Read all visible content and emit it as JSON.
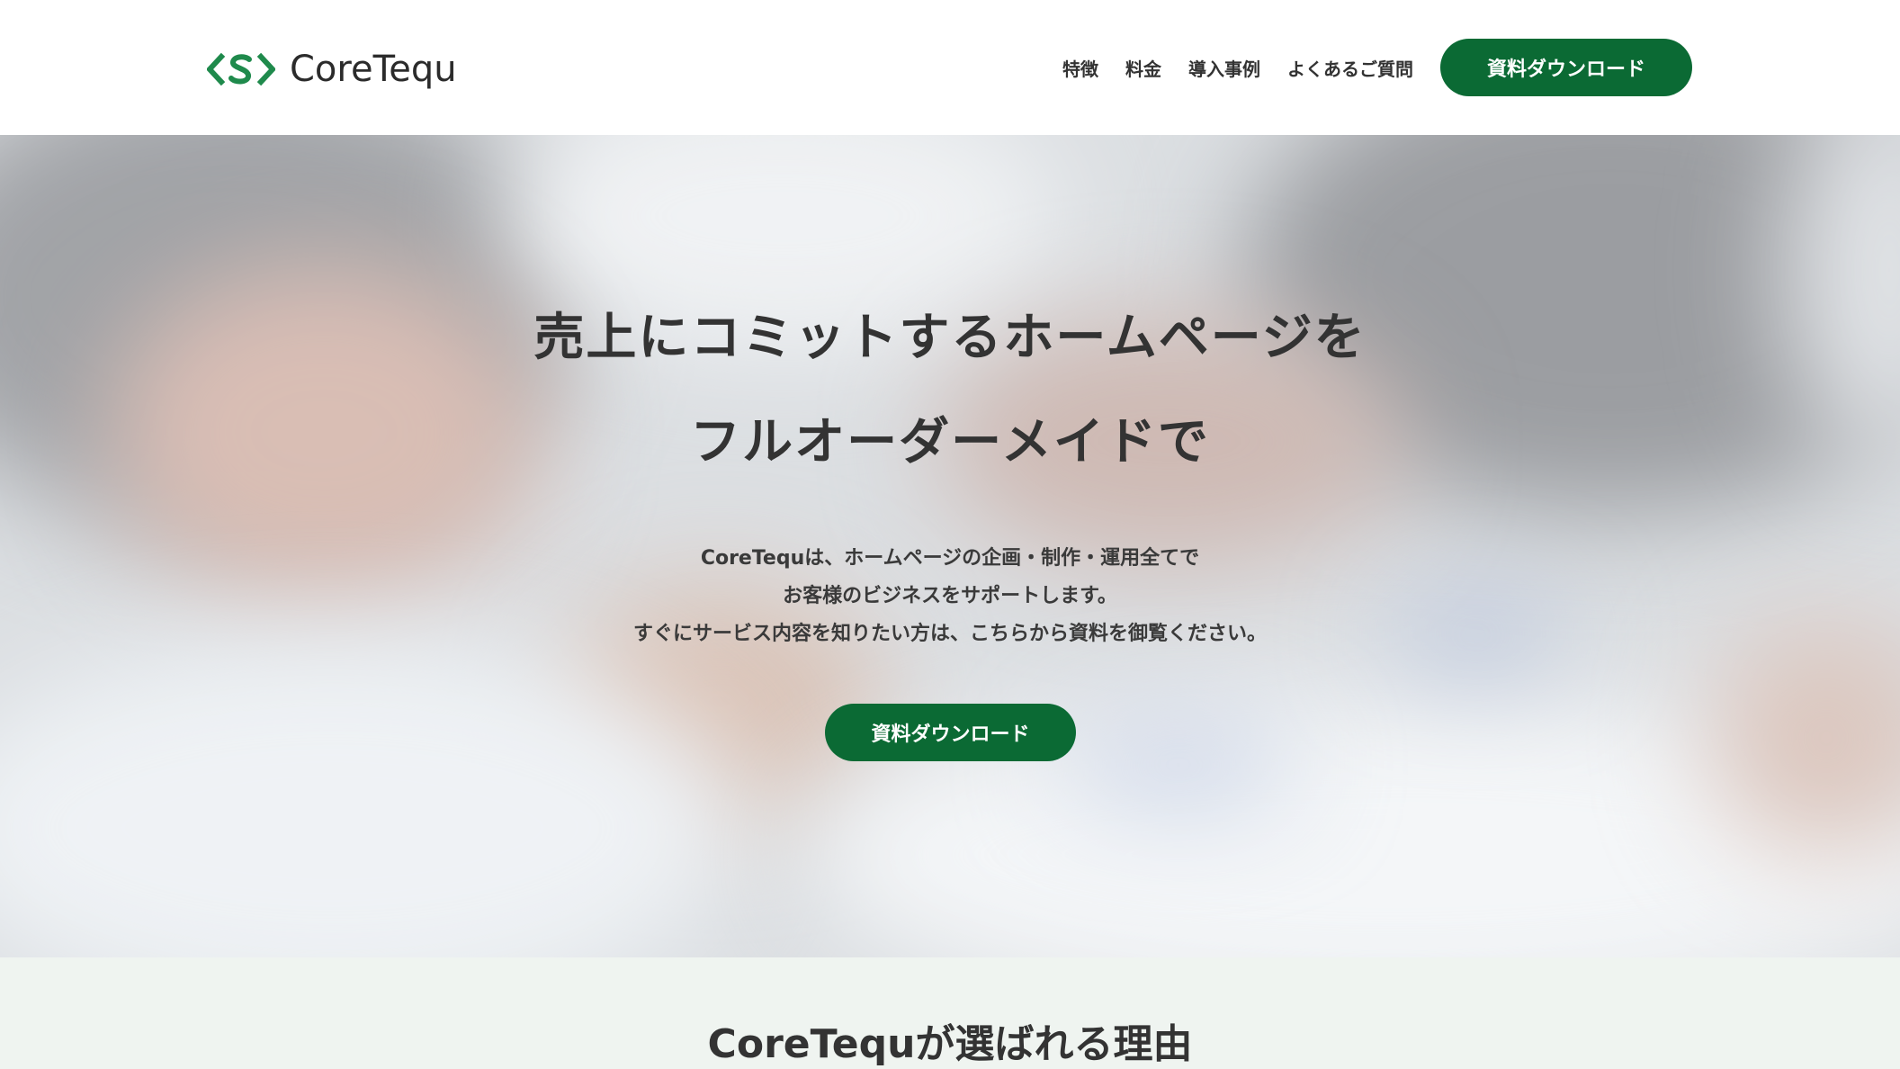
{
  "header": {
    "logo_text": "CoreTequ",
    "logo_icon": "code-brackets-s-icon",
    "nav": [
      "特徴",
      "料金",
      "導入事例",
      "よくあるご質問"
    ],
    "cta_label": "資料ダウンロード"
  },
  "hero": {
    "title_line1": "売上にコミットするホームページを",
    "title_line2": "フルオーダーメイドで",
    "desc_line1": "CoreTequは、ホームページの企画・制作・運用全てで",
    "desc_line2": "お客様のビジネスをサポートします。",
    "desc_line3": "すぐにサービス内容を知りたい方は、こちらから資料を御覧ください。",
    "cta_label": "資料ダウンロード"
  },
  "reasons": {
    "title": "CoreTequが選ばれる理由"
  },
  "colors": {
    "brand_green": "#0b6a34",
    "section_bg": "#eff4f0",
    "text": "#333333"
  }
}
